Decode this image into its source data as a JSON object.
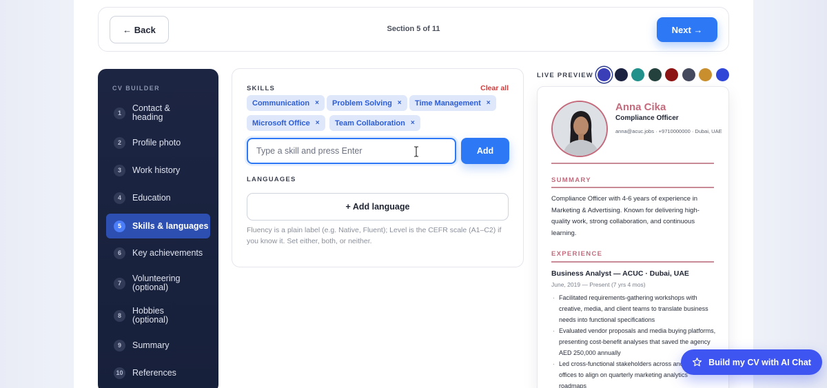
{
  "nav": {
    "back_label": "← Back",
    "section_indicator": "Section 5 of 11",
    "next_label": "Next →"
  },
  "sidebar": {
    "title": "CV BUILDER",
    "items": [
      {
        "num": "1",
        "label": "Contact & heading",
        "active": false
      },
      {
        "num": "2",
        "label": "Profile photo",
        "active": false
      },
      {
        "num": "3",
        "label": "Work history",
        "active": false
      },
      {
        "num": "4",
        "label": "Education",
        "active": false
      },
      {
        "num": "5",
        "label": "Skills & languages",
        "active": true
      },
      {
        "num": "6",
        "label": "Key achievements",
        "active": false
      },
      {
        "num": "7",
        "label": "Volunteering (optional)",
        "active": false
      },
      {
        "num": "8",
        "label": "Hobbies (optional)",
        "active": false
      },
      {
        "num": "9",
        "label": "Summary",
        "active": false
      },
      {
        "num": "10",
        "label": "References",
        "active": false
      }
    ]
  },
  "skills": {
    "heading": "SKILLS",
    "clear_all": "Clear all",
    "chips": [
      "Communication",
      "Problem Solving",
      "Time Management",
      "Microsoft Office",
      "Team Collaboration"
    ],
    "chip_remove": "×",
    "input_placeholder": "Type a skill and press Enter",
    "input_value": "",
    "add_label": "Add"
  },
  "languages": {
    "heading": "LANGUAGES",
    "add_label": "+ Add language",
    "hint": "Fluency is a plain label (e.g. Native, Fluent); Level is the CEFR scale (A1–C2) if you know it. Set either, both, or neither."
  },
  "preview": {
    "label": "LIVE PREVIEW",
    "swatches": [
      "#3a3fb8",
      "#1b2240",
      "#22918c",
      "#24413d",
      "#8c1414",
      "#45495e",
      "#c98f2e",
      "#3046d6"
    ],
    "selected_swatch": "#3a3fb8",
    "cv": {
      "name": "Anna Cika",
      "role": "Compliance Officer",
      "contact": "anna@acuc.jobs · +9710000000 · Dubai, UAE",
      "summary_heading": "SUMMARY",
      "summary": "Compliance Officer with 4-6 years of experience in Marketing & Advertising. Known for delivering high-quality work, strong collaboration, and continuous learning.",
      "experience_heading": "EXPERIENCE",
      "job_title": "Business Analyst — ACUC · Dubai, UAE",
      "job_dates": "June, 2019 — Present (7 yrs 4 mos)",
      "bullets": [
        "Facilitated requirements-gathering workshops with creative, media, and client teams to translate business needs into functional specifications",
        "Evaluated vendor proposals and media buying platforms, presenting cost-benefit analyses that saved the agency AED 250,000 annually",
        "Led cross-functional stakeholders across and regional offices to align on quarterly marketing analytics roadmaps"
      ]
    }
  },
  "ai_chat": {
    "label": "Build my CV with AI Chat",
    "icon": "star-icon"
  }
}
